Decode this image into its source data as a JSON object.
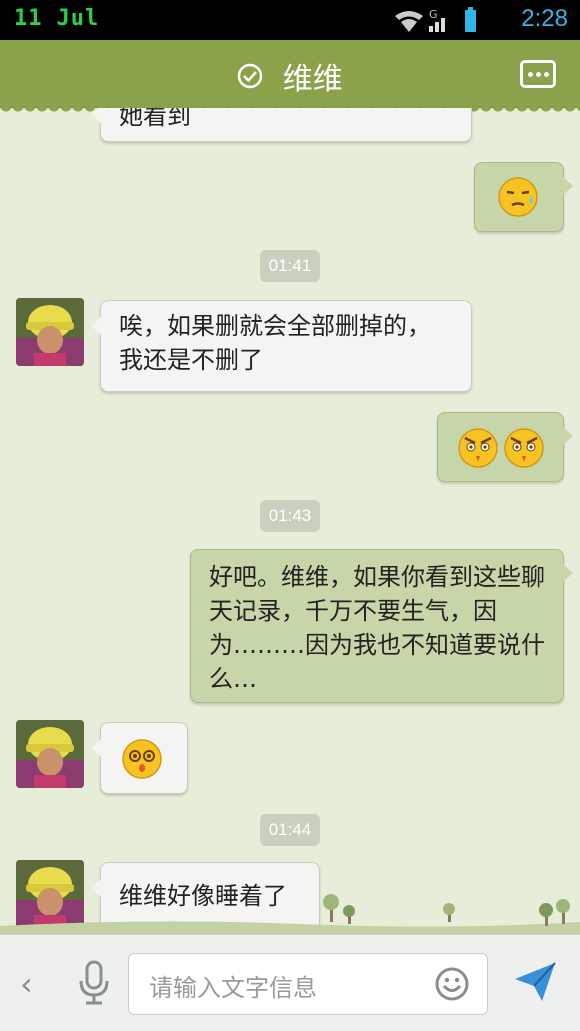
{
  "status": {
    "date_day": "11",
    "date_month": "Jul",
    "time": "2:28",
    "net": "G"
  },
  "header": {
    "title": "维维",
    "verified_icon": "check-circle-icon",
    "menu_icon": "ellipsis-icon"
  },
  "messages": [
    {
      "type": "in",
      "text": "她看到"
    },
    {
      "type": "out",
      "emoji": "sweat-face-emoji"
    },
    {
      "type": "time",
      "text": "01:41"
    },
    {
      "type": "in",
      "text": "唉，如果删就会全部删掉的，我还是不删了"
    },
    {
      "type": "out",
      "emoji": "angry-face-emoji x2"
    },
    {
      "type": "time",
      "text": "01:43"
    },
    {
      "type": "out",
      "text": "好吧。维维，如果你看到这些聊天记录，千万不要生气，因为………因为我也不知道要说什么…"
    },
    {
      "type": "in",
      "emoji": "dizzy-face-emoji"
    },
    {
      "type": "time",
      "text": "01:44"
    },
    {
      "type": "in",
      "text": "维维好像睡着了"
    }
  ],
  "inputbar": {
    "placeholder": "请输入文字信息"
  },
  "colors": {
    "header_bg": "#8aa24a",
    "outgoing_bubble": "#c7d6a8",
    "incoming_bubble": "#f4f4f2",
    "status_time": "#33b5e5"
  }
}
